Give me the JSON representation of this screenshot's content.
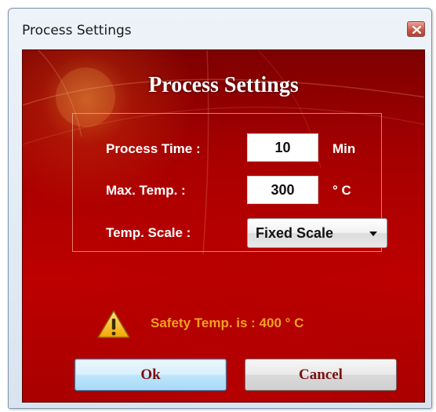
{
  "window": {
    "title": "Process Settings"
  },
  "dialog": {
    "heading": "Process Settings",
    "fields": {
      "process_time": {
        "label": "Process Time :",
        "value": "10",
        "unit": "Min"
      },
      "max_temp": {
        "label": "Max. Temp. :",
        "value": "300",
        "unit": "° C"
      },
      "temp_scale": {
        "label": "Temp. Scale :",
        "selected": "Fixed Scale"
      }
    },
    "warning": {
      "text": "Safety Temp. is : 400 ° C",
      "icon": "warning-icon"
    },
    "buttons": {
      "ok": "Ok",
      "cancel": "Cancel"
    }
  },
  "colors": {
    "background": "#b00000",
    "warning_text": "#f2a023",
    "button_text": "#7a1010"
  }
}
